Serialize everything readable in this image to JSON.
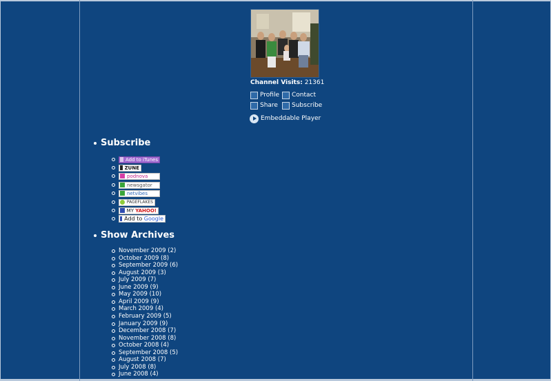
{
  "channel": {
    "visits_label": "Channel Visits:",
    "visits_count": "21361",
    "links": {
      "profile": "Profile",
      "contact": "Contact",
      "share": "Share",
      "subscribe": "Subscribe",
      "embed": "Embeddable Player"
    }
  },
  "subscribe": {
    "heading": "Subscribe",
    "badges": {
      "itunes": "Add to iTunes",
      "zune": "ZUNE",
      "podnova": "podnova",
      "newsgator": "newsgator",
      "netvibes": "netvibes",
      "pageflakes": "PAGEFLAKES",
      "myyahoo_my": "MY",
      "myyahoo_yahoo": "YAHOO!",
      "google_add": "Add to",
      "google_name": "Google"
    }
  },
  "archives": {
    "heading": "Show Archives",
    "items": [
      "November 2009 (2)",
      "October 2009 (8)",
      "September 2009 (6)",
      "August 2009 (3)",
      "July 2009 (7)",
      "June 2009 (9)",
      "May 2009 (10)",
      "April 2009 (9)",
      "March 2009 (4)",
      "February 2009 (5)",
      "January 2009 (9)",
      "December 2008 (7)",
      "November 2008 (8)",
      "October 2008 (4)",
      "September 2008 (5)",
      "August 2008 (7)",
      "July 2008 (8)",
      "June 2008 (4)"
    ]
  },
  "colors": {
    "background": "#0f457f",
    "text": "#ffffff",
    "frame": "#b9c9dc"
  }
}
